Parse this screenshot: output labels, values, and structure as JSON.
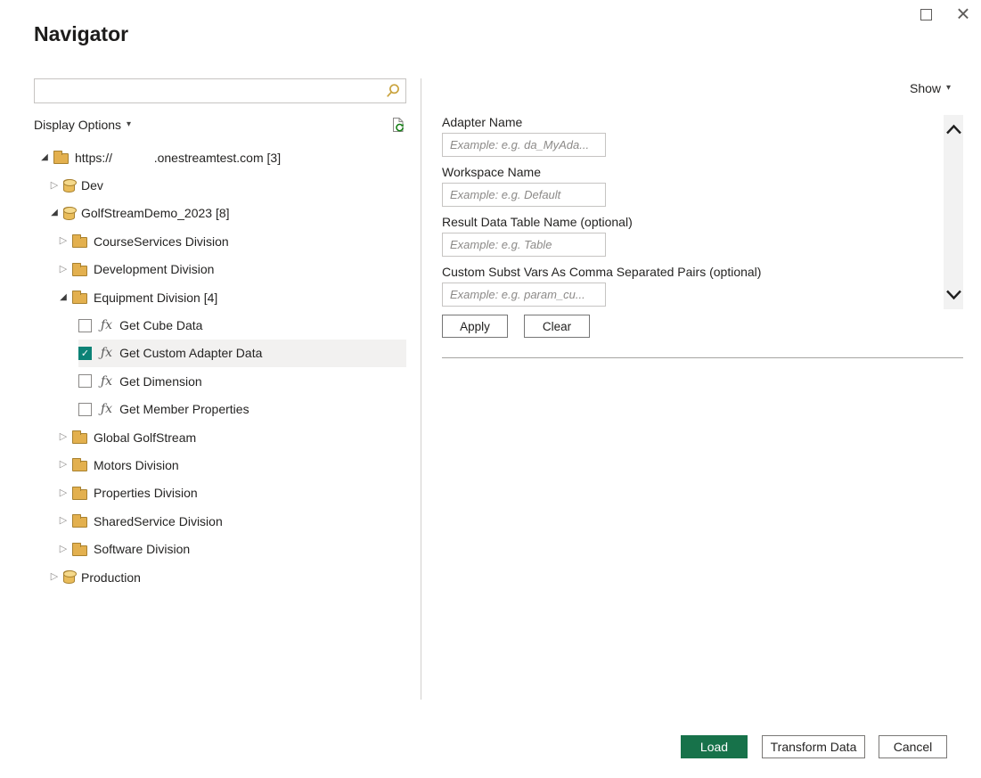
{
  "window": {
    "title": "Navigator"
  },
  "icons": {
    "caret_down": "▾",
    "expander_collapsed": "▷",
    "expander_expanded": "◢",
    "function_glyph": "ƒx",
    "check": "✓",
    "close": "×"
  },
  "left_panel": {
    "search": {
      "value": "",
      "placeholder": ""
    },
    "display_options_label": "Display Options",
    "tree": {
      "items": [
        {
          "label": "https://            .onestreamtest.com [3]",
          "type": "folder",
          "state": "expanded"
        },
        {
          "label": "Dev",
          "type": "database",
          "state": "collapsed"
        },
        {
          "label": "GolfStreamDemo_2023 [8]",
          "type": "database",
          "state": "expanded"
        },
        {
          "label": "CourseServices Division",
          "type": "folder",
          "state": "collapsed"
        },
        {
          "label": "Development Division",
          "type": "folder",
          "state": "collapsed"
        },
        {
          "label": "Equipment Division [4]",
          "type": "folder",
          "state": "expanded"
        },
        {
          "label": "Get Cube Data",
          "type": "function",
          "checked": false
        },
        {
          "label": "Get Custom Adapter Data",
          "type": "function",
          "checked": true,
          "selected": true
        },
        {
          "label": "Get Dimension",
          "type": "function",
          "checked": false
        },
        {
          "label": "Get Member Properties",
          "type": "function",
          "checked": false
        },
        {
          "label": "Global GolfStream",
          "type": "folder",
          "state": "collapsed"
        },
        {
          "label": "Motors Division",
          "type": "folder",
          "state": "collapsed"
        },
        {
          "label": "Properties Division",
          "type": "folder",
          "state": "collapsed"
        },
        {
          "label": "SharedService Division",
          "type": "folder",
          "state": "collapsed"
        },
        {
          "label": "Software Division",
          "type": "folder",
          "state": "collapsed"
        },
        {
          "label": "Production",
          "type": "database",
          "state": "collapsed"
        }
      ]
    }
  },
  "right_panel": {
    "show_label": "Show",
    "fields": [
      {
        "label": "Adapter Name",
        "placeholder": "Example: e.g. da_MyAda...",
        "value": ""
      },
      {
        "label": "Workspace Name",
        "placeholder": "Example: e.g. Default",
        "value": ""
      },
      {
        "label": "Result Data Table Name (optional)",
        "placeholder": "Example: e.g. Table",
        "value": ""
      },
      {
        "label": "Custom Subst Vars As Comma Separated Pairs (optional)",
        "placeholder": "Example: e.g. param_cu...",
        "value": ""
      }
    ],
    "apply_label": "Apply",
    "clear_label": "Clear"
  },
  "footer": {
    "load_label": "Load",
    "transform_label": "Transform Data",
    "cancel_label": "Cancel"
  },
  "colors": {
    "accent_green": "#17724A",
    "checkbox_teal": "#0C8276",
    "folder_gold": "#E3B04E",
    "selected_row_bg": "#F2F1F0"
  }
}
